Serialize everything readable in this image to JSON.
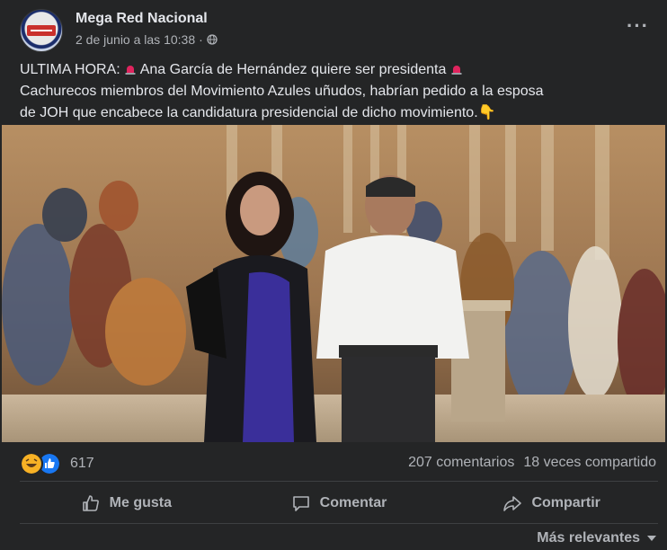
{
  "post": {
    "page_name": "Mega Red Nacional",
    "date": "2 de junio a las 10:38",
    "dot": "·",
    "more": "···",
    "text_line1_a": "ULTIMA HORA: ",
    "text_line1_b": "Ana García de Hernández quiere ser presidenta",
    "text_line2": "Cachurecos miembros del Movimiento Azules uñudos, habrían pedido a la esposa",
    "text_line3": "de JOH que encabece la candidatura presidencial de dicho movimiento.",
    "pointing_emoji": "👇"
  },
  "reactions": {
    "count": "617",
    "comments": "207 comentarios",
    "shares": "18 veces compartido"
  },
  "actions": {
    "like": "Me gusta",
    "comment": "Comentar",
    "share": "Compartir"
  },
  "sort": {
    "label": "Más relevantes"
  }
}
